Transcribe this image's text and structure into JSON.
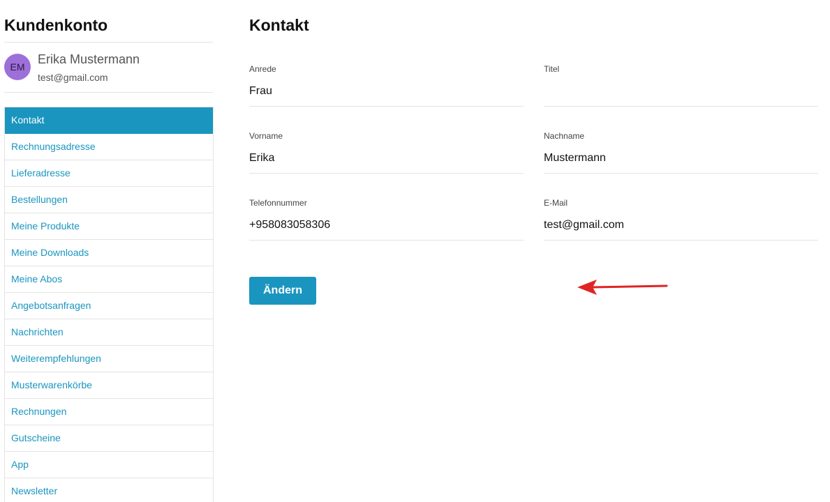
{
  "sidebar": {
    "title": "Kundenkonto",
    "user": {
      "initials": "EM",
      "name": "Erika Mustermann",
      "email": "test@gmail.com"
    },
    "nav_items": [
      {
        "label": "Kontakt",
        "active": true
      },
      {
        "label": "Rechnungsadresse"
      },
      {
        "label": "Lieferadresse"
      },
      {
        "label": "Bestellungen"
      },
      {
        "label": "Meine Produkte"
      },
      {
        "label": "Meine Downloads"
      },
      {
        "label": "Meine Abos"
      },
      {
        "label": "Angebotsanfragen"
      },
      {
        "label": "Nachrichten"
      },
      {
        "label": "Weiterempfehlungen"
      },
      {
        "label": "Musterwarenkörbe"
      },
      {
        "label": "Rechnungen"
      },
      {
        "label": "Gutscheine"
      },
      {
        "label": "App"
      },
      {
        "label": "Newsletter"
      }
    ]
  },
  "main": {
    "title": "Kontakt",
    "fields": {
      "salutation": {
        "label": "Anrede",
        "value": "Frau"
      },
      "title": {
        "label": "Titel",
        "value": ""
      },
      "first_name": {
        "label": "Vorname",
        "value": "Erika"
      },
      "last_name": {
        "label": "Nachname",
        "value": "Mustermann"
      },
      "phone": {
        "label": "Telefonnummer",
        "value": "+958083058306"
      },
      "email": {
        "label": "E-Mail",
        "value": "test@gmail.com"
      }
    },
    "edit_button_label": "Ändern"
  },
  "colors": {
    "accent": "#1a95bf",
    "avatar": "#9d6fd9",
    "annotation_arrow": "#e02424"
  }
}
